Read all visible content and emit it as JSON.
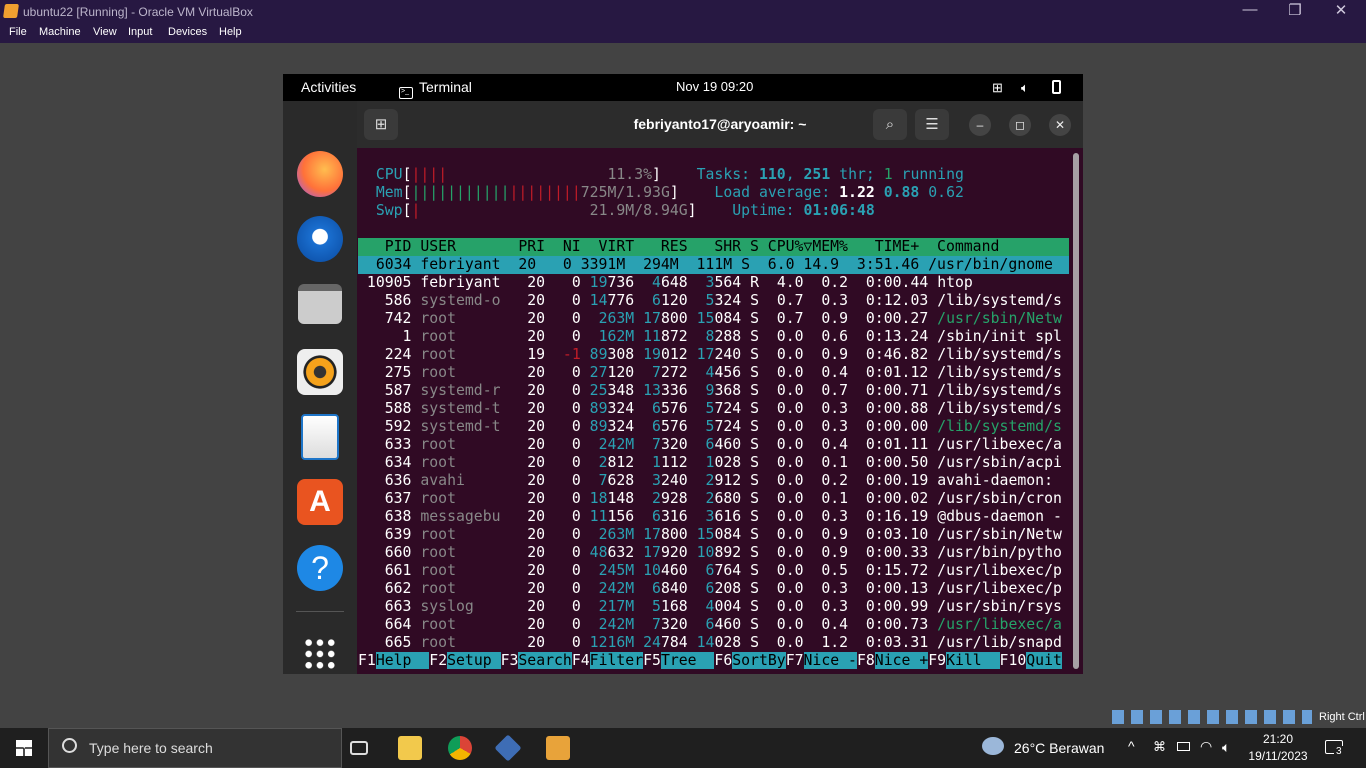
{
  "window": {
    "title": "ubuntu22 [Running] - Oracle VM VirtualBox",
    "min": "—",
    "restore": "❐",
    "close": "✕"
  },
  "menu": [
    "File",
    "Machine",
    "View",
    "Input",
    "Devices",
    "Help"
  ],
  "gnome": {
    "activities": "Activities",
    "app": "Terminal",
    "clock": "Nov 19  09:20"
  },
  "terminal": {
    "title": "febriyanto17@aryoamir: ~"
  },
  "htop": {
    "meters": [
      [
        [
          "CPU",
          "c"
        ],
        [
          "[",
          "w"
        ],
        [
          "||||",
          "r"
        ],
        [
          "                  ",
          "w"
        ],
        [
          "11.3%",
          "gray"
        ],
        [
          "]",
          "w"
        ],
        [
          "    ",
          "w"
        ],
        [
          "Tasks: ",
          "c"
        ],
        [
          "110",
          "bc"
        ],
        [
          ", ",
          "c"
        ],
        [
          "251",
          "bc"
        ],
        [
          " thr; ",
          "c"
        ],
        [
          "1",
          "g"
        ],
        [
          " running",
          "c"
        ]
      ],
      [
        [
          "Mem",
          "c"
        ],
        [
          "[",
          "w"
        ],
        [
          "|||||||||||",
          "g"
        ],
        [
          "||||||||",
          "r"
        ],
        [
          "725M/1.93G",
          "gray"
        ],
        [
          "]",
          "w"
        ],
        [
          "    ",
          "w"
        ],
        [
          "Load average: ",
          "c"
        ],
        [
          "1.22",
          "b"
        ],
        [
          " ",
          "w"
        ],
        [
          "0.88",
          "bc"
        ],
        [
          " ",
          "w"
        ],
        [
          "0.62",
          "c"
        ]
      ],
      [
        [
          "Swp",
          "c"
        ],
        [
          "[",
          "w"
        ],
        [
          "|",
          "r"
        ],
        [
          "                   ",
          "w"
        ],
        [
          "21.9M/8.94G",
          "gray"
        ],
        [
          "]",
          "w"
        ],
        [
          "    ",
          "w"
        ],
        [
          "Uptime: ",
          "c"
        ],
        [
          "01:06:48",
          "bc"
        ]
      ]
    ],
    "header": "   PID USER       PRI  NI  VIRT   RES   SHR S CPU%▽MEM%   TIME+  Command      ",
    "selected": "  6034 febriyant  20   0 3391M  294M  111M S  6.0 14.9  3:51.46 /usr/bin/gnome",
    "rows": [
      [
        "10905",
        "febriyant",
        "20",
        "0",
        "19736",
        "4648",
        "3564",
        "R",
        "4.0",
        "0.2",
        "0:00.44",
        "htop",
        "w"
      ],
      [
        "586",
        "systemd-o",
        "20",
        "0",
        "14776",
        "6120",
        "5324",
        "S",
        "0.7",
        "0.3",
        "0:12.03",
        "/lib/systemd/s",
        "w"
      ],
      [
        "742",
        "root",
        "20",
        "0",
        "263M",
        "17800",
        "15084",
        "S",
        "0.7",
        "0.9",
        "0:00.27",
        "/usr/sbin/Netw",
        "g"
      ],
      [
        "1",
        "root",
        "20",
        "0",
        "162M",
        "11872",
        "8288",
        "S",
        "0.0",
        "0.6",
        "0:13.24",
        "/sbin/init spl",
        "w"
      ],
      [
        "224",
        "root",
        "19",
        "-1",
        "89308",
        "19012",
        "17240",
        "S",
        "0.0",
        "0.9",
        "0:46.82",
        "/lib/systemd/s",
        "w"
      ],
      [
        "275",
        "root",
        "20",
        "0",
        "27120",
        "7272",
        "4456",
        "S",
        "0.0",
        "0.4",
        "0:01.12",
        "/lib/systemd/s",
        "w"
      ],
      [
        "587",
        "systemd-r",
        "20",
        "0",
        "25348",
        "13336",
        "9368",
        "S",
        "0.0",
        "0.7",
        "0:00.71",
        "/lib/systemd/s",
        "w"
      ],
      [
        "588",
        "systemd-t",
        "20",
        "0",
        "89324",
        "6576",
        "5724",
        "S",
        "0.0",
        "0.3",
        "0:00.88",
        "/lib/systemd/s",
        "w"
      ],
      [
        "592",
        "systemd-t",
        "20",
        "0",
        "89324",
        "6576",
        "5724",
        "S",
        "0.0",
        "0.3",
        "0:00.00",
        "/lib/systemd/s",
        "g"
      ],
      [
        "633",
        "root",
        "20",
        "0",
        "242M",
        "7320",
        "6460",
        "S",
        "0.0",
        "0.4",
        "0:01.11",
        "/usr/libexec/a",
        "w"
      ],
      [
        "634",
        "root",
        "20",
        "0",
        "2812",
        "1112",
        "1028",
        "S",
        "0.0",
        "0.1",
        "0:00.50",
        "/usr/sbin/acpi",
        "w"
      ],
      [
        "636",
        "avahi",
        "20",
        "0",
        "7628",
        "3240",
        "2912",
        "S",
        "0.0",
        "0.2",
        "0:00.19",
        "avahi-daemon: ",
        "w"
      ],
      [
        "637",
        "root",
        "20",
        "0",
        "18148",
        "2928",
        "2680",
        "S",
        "0.0",
        "0.1",
        "0:00.02",
        "/usr/sbin/cron",
        "w"
      ],
      [
        "638",
        "messagebu",
        "20",
        "0",
        "11156",
        "6316",
        "3616",
        "S",
        "0.0",
        "0.3",
        "0:16.19",
        "@dbus-daemon -",
        "w"
      ],
      [
        "639",
        "root",
        "20",
        "0",
        "263M",
        "17800",
        "15084",
        "S",
        "0.0",
        "0.9",
        "0:03.10",
        "/usr/sbin/Netw",
        "w"
      ],
      [
        "660",
        "root",
        "20",
        "0",
        "48632",
        "17920",
        "10892",
        "S",
        "0.0",
        "0.9",
        "0:00.33",
        "/usr/bin/pytho",
        "w"
      ],
      [
        "661",
        "root",
        "20",
        "0",
        "245M",
        "10460",
        "6764",
        "S",
        "0.0",
        "0.5",
        "0:15.72",
        "/usr/libexec/p",
        "w"
      ],
      [
        "662",
        "root",
        "20",
        "0",
        "242M",
        "6840",
        "6208",
        "S",
        "0.0",
        "0.3",
        "0:00.13",
        "/usr/libexec/p",
        "w"
      ],
      [
        "663",
        "syslog",
        "20",
        "0",
        "217M",
        "5168",
        "4004",
        "S",
        "0.0",
        "0.3",
        "0:00.99",
        "/usr/sbin/rsys",
        "w"
      ],
      [
        "664",
        "root",
        "20",
        "0",
        "242M",
        "7320",
        "6460",
        "S",
        "0.0",
        "0.4",
        "0:00.73",
        "/usr/libexec/a",
        "g"
      ],
      [
        "665",
        "root",
        "20",
        "0",
        "1216M",
        "24784",
        "14028",
        "S",
        "0.0",
        "1.2",
        "0:03.31",
        "/usr/lib/snapd",
        "w"
      ]
    ],
    "fkeys": [
      [
        "F1",
        "Help  "
      ],
      [
        "F2",
        "Setup "
      ],
      [
        "F3",
        "Search"
      ],
      [
        "F4",
        "Filter"
      ],
      [
        "F5",
        "Tree  "
      ],
      [
        "F6",
        "SortBy"
      ],
      [
        "F7",
        "Nice -"
      ],
      [
        "F8",
        "Nice +"
      ],
      [
        "F9",
        "Kill  "
      ],
      [
        "F10",
        "Quit"
      ]
    ]
  },
  "taskbar": {
    "search": "Type here to search",
    "weather": "26°C  Berawan",
    "time": "21:20",
    "date": "19/11/2023",
    "notif": "3"
  },
  "vbox": {
    "hostkey": "Right Ctrl"
  },
  "colors": {
    "terminal_bg": "#300a24",
    "htop_header": "#26a269",
    "htop_select": "#2aa1b3"
  }
}
